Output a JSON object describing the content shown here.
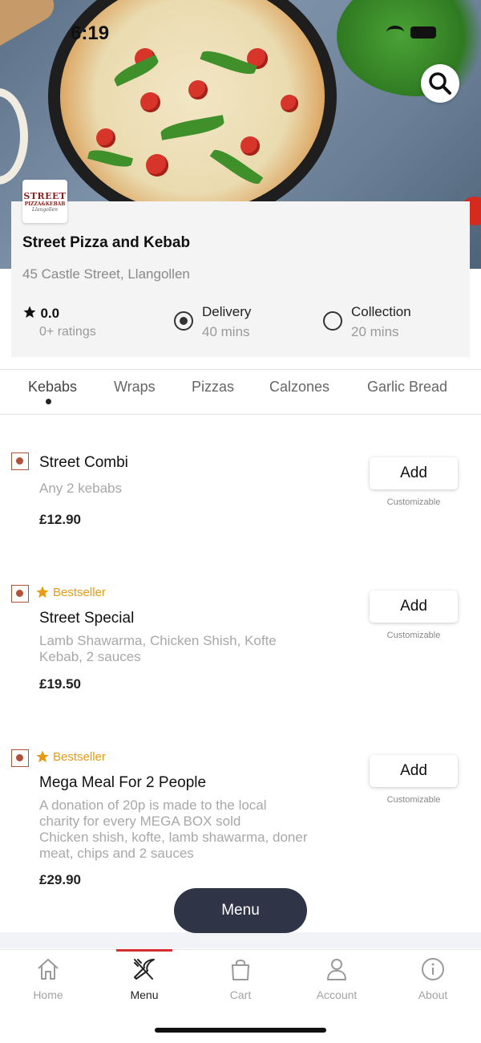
{
  "status_bar": {
    "time": "6:19"
  },
  "hero": {
    "search_icon": "search-icon"
  },
  "restaurant": {
    "logo_text": [
      "STREET",
      "PIZZA&KEBAB",
      "Llangollen"
    ],
    "name": "Street Pizza and Kebab",
    "address": "45 Castle Street, Llangollen",
    "rating": "0.0",
    "ratings_count": "0+ ratings",
    "options": [
      {
        "label": "Delivery",
        "time": "40 mins",
        "selected": true
      },
      {
        "label": "Collection",
        "time": "20 mins",
        "selected": false
      }
    ]
  },
  "tabs": [
    "Kebabs",
    "Wraps",
    "Pizzas",
    "Calzones",
    "Garlic Bread"
  ],
  "items": [
    {
      "bestseller": "",
      "name": "Street Combi",
      "desc": "Any 2 kebabs",
      "price": "£12.90",
      "add": "Add",
      "note": "Customizable"
    },
    {
      "bestseller": "Bestseller",
      "name": "Street Special",
      "desc": "Lamb Shawarma, Chicken Shish, Kofte\nKebab, 2 sauces",
      "price": "£19.50",
      "add": "Add",
      "note": "Customizable"
    },
    {
      "bestseller": "Bestseller",
      "name": "Mega Meal For 2 People",
      "desc": "A donation of 20p is made to the local\ncharity for  every MEGA BOX sold\nChicken shish, kofte, lamb shawarma, doner\nmeat, chips and 2 sauces",
      "price": "£29.90",
      "add": "Add",
      "note": "Customizable"
    }
  ],
  "menu_button": "Menu",
  "nav": [
    {
      "label": "Home",
      "icon": "home-icon"
    },
    {
      "label": "Menu",
      "icon": "fork-knife-icon",
      "active": true
    },
    {
      "label": "Cart",
      "icon": "shopping-bag-icon"
    },
    {
      "label": "Account",
      "icon": "user-icon"
    },
    {
      "label": "About",
      "icon": "info-icon"
    }
  ],
  "colors": {
    "accent": "#d32f2f",
    "bestseller": "#e89a10",
    "menu_pill": "#2f3546",
    "veg_marker": "#b0523a"
  }
}
